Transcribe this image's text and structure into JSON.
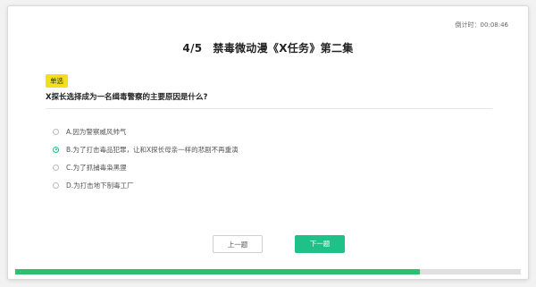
{
  "timer": {
    "label": "倒计时：",
    "value": "00:08:46"
  },
  "quiz": {
    "number": "4/5",
    "title": "禁毒微动漫《X任务》第二集",
    "type_tag": "单选",
    "question": "X探长选择成为一名缉毒警察的主要原因是什么?",
    "options": [
      {
        "label": "A.因为警察威风帅气",
        "selected": false
      },
      {
        "label": "B.为了打击毒品犯罪，让和X探长母亲一样的悲剧不再重演",
        "selected": true
      },
      {
        "label": "C.为了抓捕毒枭黑狸",
        "selected": false
      },
      {
        "label": "D.为打击地下制毒工厂",
        "selected": false
      }
    ]
  },
  "buttons": {
    "prev_label": "上一题",
    "next_label": "下一题"
  },
  "progress": {
    "fraction": 0.8
  },
  "colors": {
    "accent": "#1ec288",
    "tag": "#f6dd1d",
    "progress": "#2fbf71"
  }
}
